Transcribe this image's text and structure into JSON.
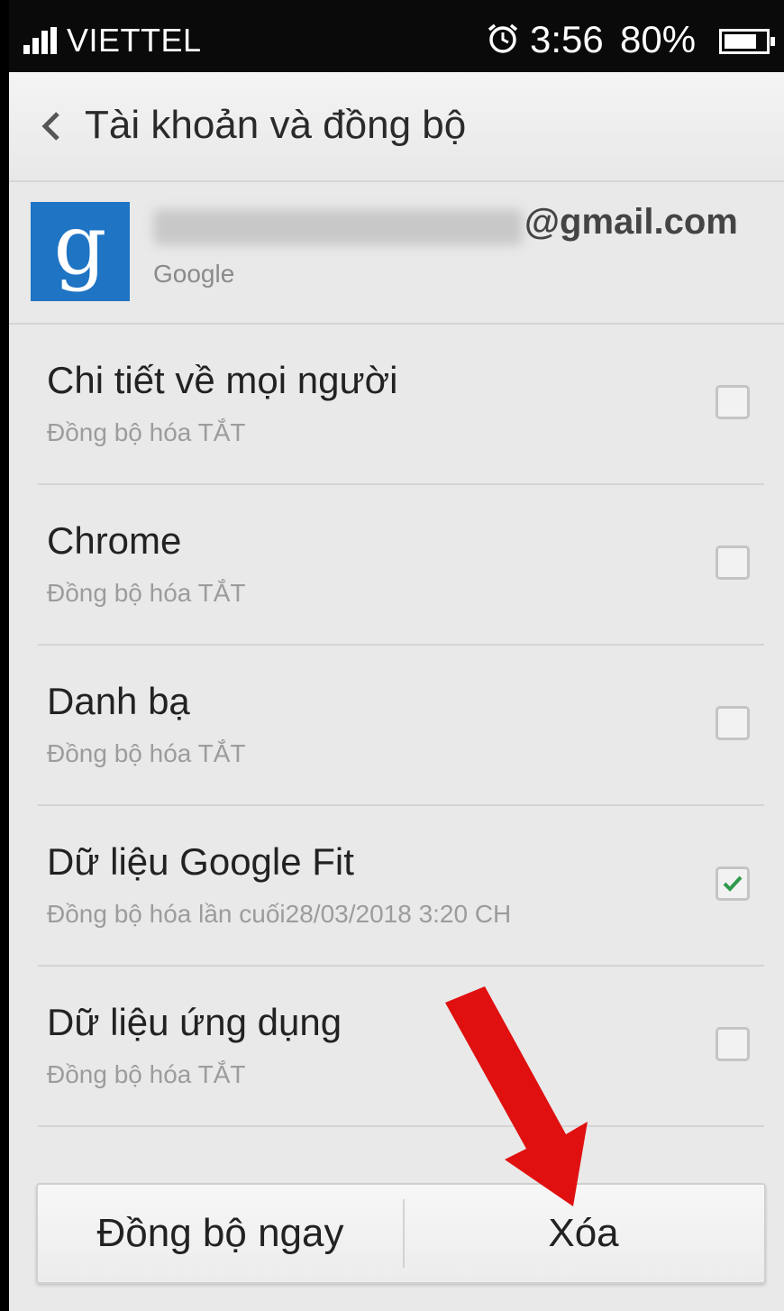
{
  "status_bar": {
    "carrier": "VIETTEL",
    "time": "3:56",
    "battery": "80%",
    "battery_level": 0.8,
    "signal_icon": "signal-bars-icon",
    "alarm_icon": "alarm-clock-icon",
    "battery_icon": "battery-icon"
  },
  "header": {
    "title": "Tài khoản và đồng bộ",
    "back_icon": "chevron-left-icon"
  },
  "account": {
    "logo_letter": "g",
    "email_suffix": "@gmail.com",
    "provider": "Google",
    "logo_color": "#1f74c4"
  },
  "sync_items": [
    {
      "label": "Chi tiết về mọi người",
      "status": "Đồng bộ hóa TẮT",
      "checked": false
    },
    {
      "label": "Chrome",
      "status": "Đồng bộ hóa TẮT",
      "checked": false
    },
    {
      "label": "Danh bạ",
      "status": "Đồng bộ hóa TẮT",
      "checked": false
    },
    {
      "label": "Dữ liệu Google Fit",
      "status": "Đồng bộ hóa lần cuối28/03/2018 3:20 CH",
      "checked": true
    },
    {
      "label": "Dữ liệu ứng dụng",
      "status": "Đồng bộ hóa TẮT",
      "checked": false
    }
  ],
  "actions": {
    "sync_now": "Đồng bộ ngay",
    "delete": "Xóa"
  },
  "colors": {
    "checkmark": "#2e9a4a",
    "annotation_arrow": "#e01010"
  }
}
